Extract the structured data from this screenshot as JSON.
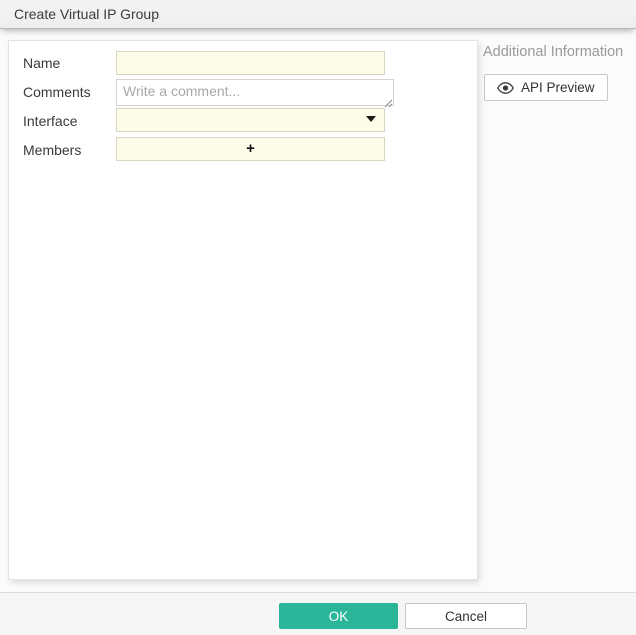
{
  "titlebar": {
    "title": "Create Virtual IP Group"
  },
  "form": {
    "name": {
      "label": "Name",
      "value": ""
    },
    "comments": {
      "label": "Comments",
      "value": "",
      "placeholder": "Write a comment..."
    },
    "interface": {
      "label": "Interface",
      "selected_value": ""
    },
    "members": {
      "label": "Members",
      "add_glyph": "+"
    }
  },
  "sidebar": {
    "heading": "Additional Information",
    "api_preview_label": "API Preview"
  },
  "footer": {
    "ok_label": "OK",
    "cancel_label": "Cancel"
  },
  "colors": {
    "accent": "#2bb69a",
    "field_background": "#fdfce8",
    "titlebar_background": "#f1f1f1",
    "footer_background": "#f6f6f6"
  }
}
